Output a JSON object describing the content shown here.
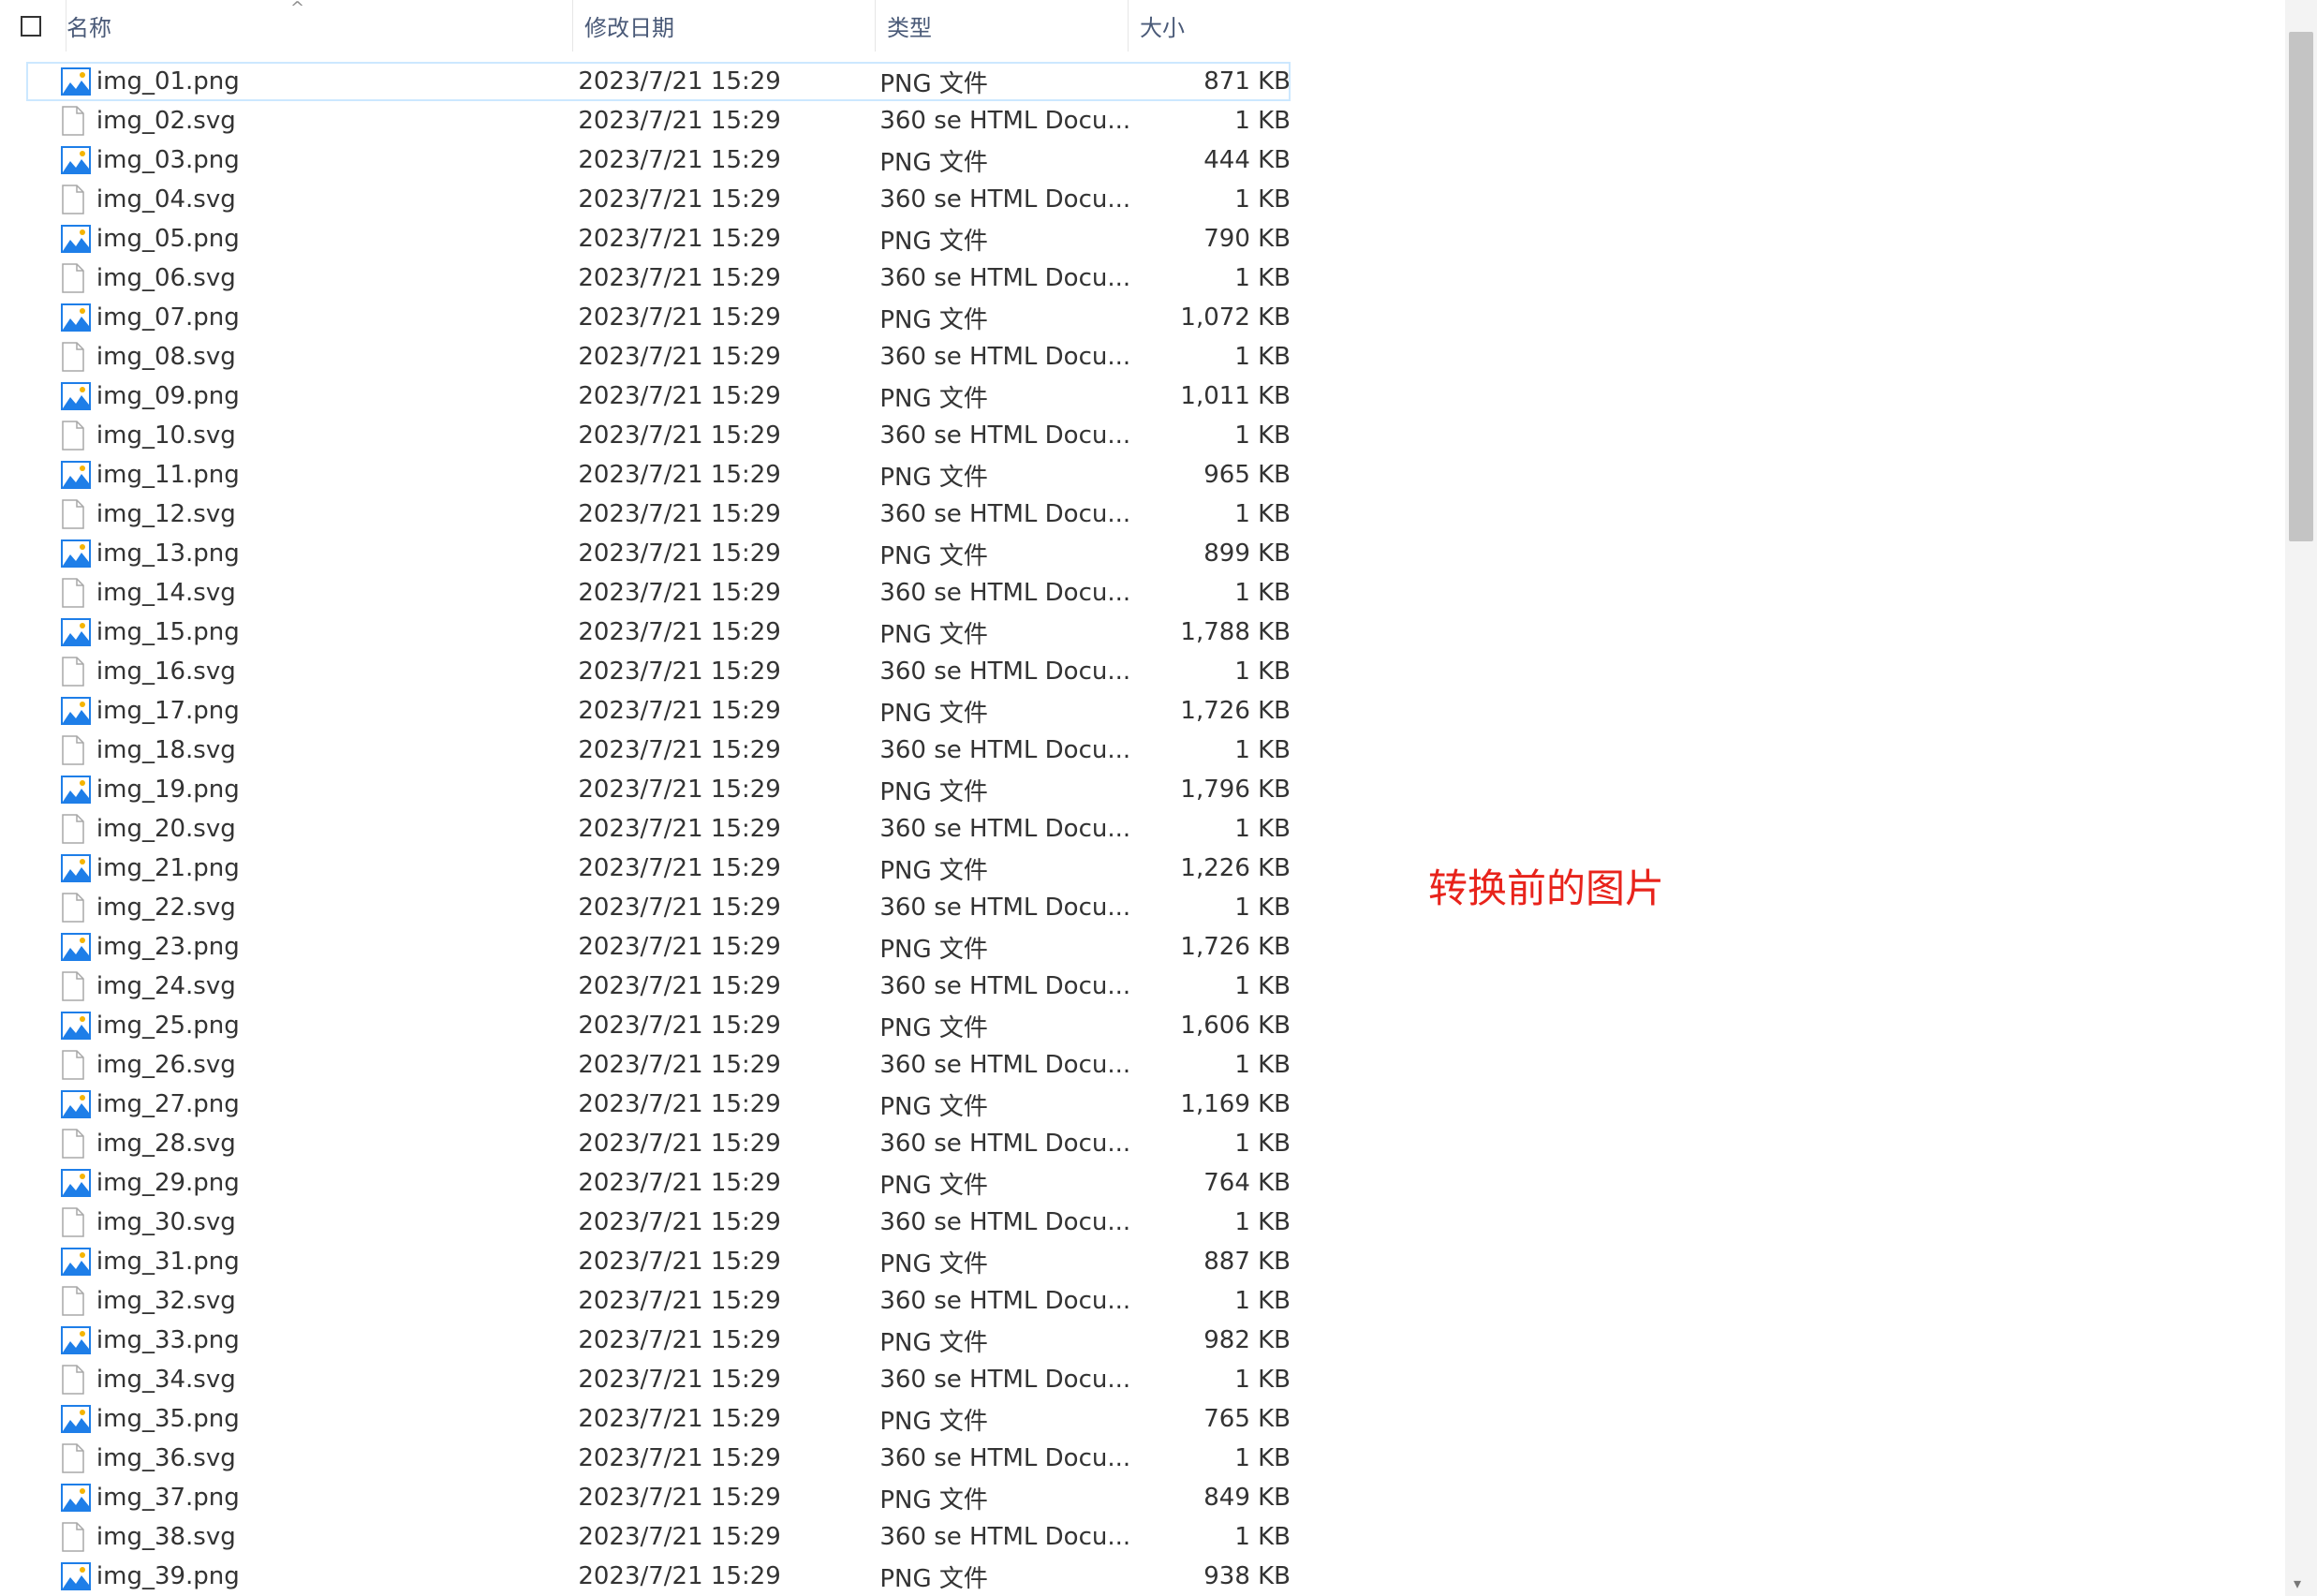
{
  "header": {
    "name": "名称",
    "date": "修改日期",
    "type": "类型",
    "size": "大小",
    "sort_indicator": "^"
  },
  "icons": {
    "png": "image-file-icon",
    "svg": "blank-file-icon"
  },
  "colors": {
    "accent": "#1e90ff",
    "note": "#e8231b"
  },
  "files": [
    {
      "name": "img_01.png",
      "date": "2023/7/21 15:29",
      "type": "PNG 文件",
      "size": "871 KB",
      "kind": "png"
    },
    {
      "name": "img_02.svg",
      "date": "2023/7/21 15:29",
      "type": "360 se HTML Docu...",
      "size": "1 KB",
      "kind": "svg"
    },
    {
      "name": "img_03.png",
      "date": "2023/7/21 15:29",
      "type": "PNG 文件",
      "size": "444 KB",
      "kind": "png"
    },
    {
      "name": "img_04.svg",
      "date": "2023/7/21 15:29",
      "type": "360 se HTML Docu...",
      "size": "1 KB",
      "kind": "svg"
    },
    {
      "name": "img_05.png",
      "date": "2023/7/21 15:29",
      "type": "PNG 文件",
      "size": "790 KB",
      "kind": "png"
    },
    {
      "name": "img_06.svg",
      "date": "2023/7/21 15:29",
      "type": "360 se HTML Docu...",
      "size": "1 KB",
      "kind": "svg"
    },
    {
      "name": "img_07.png",
      "date": "2023/7/21 15:29",
      "type": "PNG 文件",
      "size": "1,072 KB",
      "kind": "png"
    },
    {
      "name": "img_08.svg",
      "date": "2023/7/21 15:29",
      "type": "360 se HTML Docu...",
      "size": "1 KB",
      "kind": "svg"
    },
    {
      "name": "img_09.png",
      "date": "2023/7/21 15:29",
      "type": "PNG 文件",
      "size": "1,011 KB",
      "kind": "png"
    },
    {
      "name": "img_10.svg",
      "date": "2023/7/21 15:29",
      "type": "360 se HTML Docu...",
      "size": "1 KB",
      "kind": "svg"
    },
    {
      "name": "img_11.png",
      "date": "2023/7/21 15:29",
      "type": "PNG 文件",
      "size": "965 KB",
      "kind": "png"
    },
    {
      "name": "img_12.svg",
      "date": "2023/7/21 15:29",
      "type": "360 se HTML Docu...",
      "size": "1 KB",
      "kind": "svg"
    },
    {
      "name": "img_13.png",
      "date": "2023/7/21 15:29",
      "type": "PNG 文件",
      "size": "899 KB",
      "kind": "png"
    },
    {
      "name": "img_14.svg",
      "date": "2023/7/21 15:29",
      "type": "360 se HTML Docu...",
      "size": "1 KB",
      "kind": "svg"
    },
    {
      "name": "img_15.png",
      "date": "2023/7/21 15:29",
      "type": "PNG 文件",
      "size": "1,788 KB",
      "kind": "png"
    },
    {
      "name": "img_16.svg",
      "date": "2023/7/21 15:29",
      "type": "360 se HTML Docu...",
      "size": "1 KB",
      "kind": "svg"
    },
    {
      "name": "img_17.png",
      "date": "2023/7/21 15:29",
      "type": "PNG 文件",
      "size": "1,726 KB",
      "kind": "png"
    },
    {
      "name": "img_18.svg",
      "date": "2023/7/21 15:29",
      "type": "360 se HTML Docu...",
      "size": "1 KB",
      "kind": "svg"
    },
    {
      "name": "img_19.png",
      "date": "2023/7/21 15:29",
      "type": "PNG 文件",
      "size": "1,796 KB",
      "kind": "png"
    },
    {
      "name": "img_20.svg",
      "date": "2023/7/21 15:29",
      "type": "360 se HTML Docu...",
      "size": "1 KB",
      "kind": "svg"
    },
    {
      "name": "img_21.png",
      "date": "2023/7/21 15:29",
      "type": "PNG 文件",
      "size": "1,226 KB",
      "kind": "png"
    },
    {
      "name": "img_22.svg",
      "date": "2023/7/21 15:29",
      "type": "360 se HTML Docu...",
      "size": "1 KB",
      "kind": "svg"
    },
    {
      "name": "img_23.png",
      "date": "2023/7/21 15:29",
      "type": "PNG 文件",
      "size": "1,726 KB",
      "kind": "png"
    },
    {
      "name": "img_24.svg",
      "date": "2023/7/21 15:29",
      "type": "360 se HTML Docu...",
      "size": "1 KB",
      "kind": "svg"
    },
    {
      "name": "img_25.png",
      "date": "2023/7/21 15:29",
      "type": "PNG 文件",
      "size": "1,606 KB",
      "kind": "png"
    },
    {
      "name": "img_26.svg",
      "date": "2023/7/21 15:29",
      "type": "360 se HTML Docu...",
      "size": "1 KB",
      "kind": "svg"
    },
    {
      "name": "img_27.png",
      "date": "2023/7/21 15:29",
      "type": "PNG 文件",
      "size": "1,169 KB",
      "kind": "png"
    },
    {
      "name": "img_28.svg",
      "date": "2023/7/21 15:29",
      "type": "360 se HTML Docu...",
      "size": "1 KB",
      "kind": "svg"
    },
    {
      "name": "img_29.png",
      "date": "2023/7/21 15:29",
      "type": "PNG 文件",
      "size": "764 KB",
      "kind": "png"
    },
    {
      "name": "img_30.svg",
      "date": "2023/7/21 15:29",
      "type": "360 se HTML Docu...",
      "size": "1 KB",
      "kind": "svg"
    },
    {
      "name": "img_31.png",
      "date": "2023/7/21 15:29",
      "type": "PNG 文件",
      "size": "887 KB",
      "kind": "png"
    },
    {
      "name": "img_32.svg",
      "date": "2023/7/21 15:29",
      "type": "360 se HTML Docu...",
      "size": "1 KB",
      "kind": "svg"
    },
    {
      "name": "img_33.png",
      "date": "2023/7/21 15:29",
      "type": "PNG 文件",
      "size": "982 KB",
      "kind": "png"
    },
    {
      "name": "img_34.svg",
      "date": "2023/7/21 15:29",
      "type": "360 se HTML Docu...",
      "size": "1 KB",
      "kind": "svg"
    },
    {
      "name": "img_35.png",
      "date": "2023/7/21 15:29",
      "type": "PNG 文件",
      "size": "765 KB",
      "kind": "png"
    },
    {
      "name": "img_36.svg",
      "date": "2023/7/21 15:29",
      "type": "360 se HTML Docu...",
      "size": "1 KB",
      "kind": "svg"
    },
    {
      "name": "img_37.png",
      "date": "2023/7/21 15:29",
      "type": "PNG 文件",
      "size": "849 KB",
      "kind": "png"
    },
    {
      "name": "img_38.svg",
      "date": "2023/7/21 15:29",
      "type": "360 se HTML Docu...",
      "size": "1 KB",
      "kind": "svg"
    },
    {
      "name": "img_39.png",
      "date": "2023/7/21 15:29",
      "type": "PNG 文件",
      "size": "938 KB",
      "kind": "png"
    }
  ],
  "selected_file": "img_01.png",
  "note": "转换前的图片"
}
